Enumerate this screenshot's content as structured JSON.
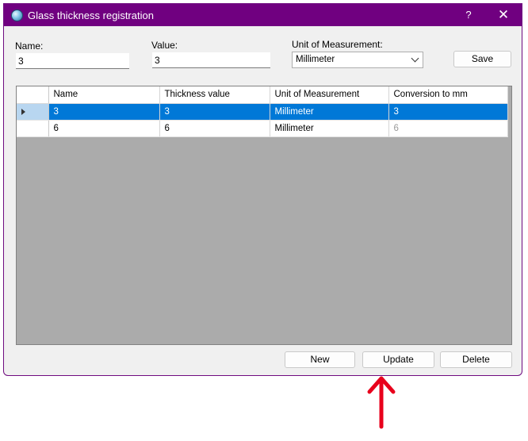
{
  "window": {
    "title": "Glass thickness registration",
    "help": "?",
    "close": "✕"
  },
  "form": {
    "name_label": "Name:",
    "name_value": "3",
    "value_label": "Value:",
    "value_value": "3",
    "unit_label": "Unit of Measurement:",
    "unit_selected": "Millimeter",
    "save_label": "Save"
  },
  "grid": {
    "columns": [
      "Name",
      "Thickness value",
      "Unit of Measurement",
      "Conversion to mm"
    ],
    "rows": [
      {
        "name": "3",
        "thickness": "3",
        "unit": "Millimeter",
        "conversion": "3",
        "selected": true
      },
      {
        "name": "6",
        "thickness": "6",
        "unit": "Millimeter",
        "conversion": "6",
        "selected": false
      }
    ]
  },
  "actions": {
    "new_label": "New",
    "update_label": "Update",
    "delete_label": "Delete"
  },
  "colors": {
    "titlebar": "#700080",
    "selection": "#0078d7",
    "annotation_arrow": "#e8001c"
  }
}
